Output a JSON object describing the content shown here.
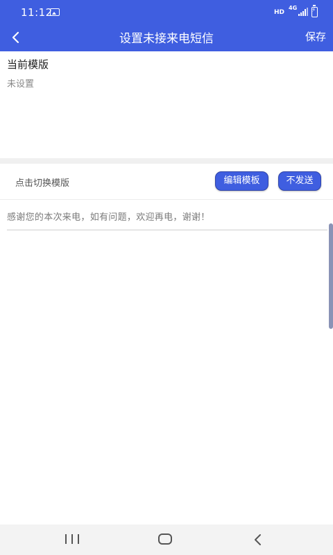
{
  "status_bar": {
    "time": "11:12",
    "hd": "HD",
    "network": "4G"
  },
  "app_bar": {
    "title": "设置未接来电短信",
    "save_label": "保存"
  },
  "current_template": {
    "label": "当前模版",
    "value": "未设置"
  },
  "switch_row": {
    "label": "点击切换模版",
    "edit_button": "编辑模板",
    "no_send_button": "不发送"
  },
  "message": {
    "placeholder": "感谢您的本次来电，如有问题，欢迎再电，谢谢！"
  },
  "colors": {
    "primary": "#3f5ee0",
    "background": "#ffffff",
    "divider": "#f0f0f0"
  }
}
